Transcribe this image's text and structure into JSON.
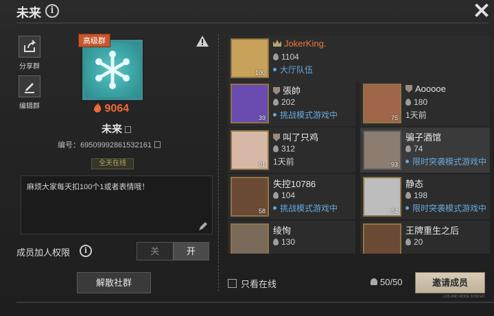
{
  "header": {
    "title": "未来",
    "info_icon": "info-icon",
    "close_icon": "close-icon"
  },
  "side": [
    {
      "label": "分享群",
      "icon": "share-icon"
    },
    {
      "label": "编辑群",
      "icon": "edit-icon"
    }
  ],
  "group": {
    "badge": "高级群",
    "avatar_icon": "snowflake-icon",
    "heat": "9064",
    "name": "未来",
    "id_text": "编号：69509992861532161",
    "online_tag": "全天在线",
    "notice": "麻烦大家每天扣100个1或者表情哦！"
  },
  "permission": {
    "label": "成员加人权限",
    "off": "关",
    "on": "开",
    "value": "开"
  },
  "dissolve_label": "解散社群",
  "members": [
    {
      "name": "JokerKing.",
      "heat": "1104",
      "status": "大厅队伍",
      "level": "100",
      "online": true,
      "leader": true,
      "color": "#c8a15a"
    },
    {
      "name": "張帥",
      "heat": "202",
      "status": "挑战模式游戏中",
      "level": "39",
      "online": true,
      "color": "#6a4bb0"
    },
    {
      "name": "Aooooe",
      "heat": "180",
      "status": "1天前",
      "level": "75",
      "online": false,
      "color": "#a0664a"
    },
    {
      "name": "叫了只鸡",
      "heat": "312",
      "status": "1天前",
      "level": "91",
      "online": false,
      "color": "#d7b7a5"
    },
    {
      "name": "骗子酒馆",
      "heat": "74",
      "status": "限时突袭模式游戏中",
      "level": "93",
      "online": true,
      "color": "#8d7c70"
    },
    {
      "name": "失控10786",
      "heat": "104",
      "status": "挑战模式游戏中",
      "level": "58",
      "online": true,
      "color": "#6b4a35"
    },
    {
      "name": "静态",
      "heat": "198",
      "status": "限时突袭模式游戏中",
      "level": "84",
      "online": true,
      "color": "#bdbdbd"
    },
    {
      "name": "绫恂",
      "heat": "130",
      "status": "",
      "level": "",
      "online": false,
      "color": "#7a6a5a"
    },
    {
      "name": "王牌重生之后",
      "heat": "20",
      "status": "",
      "level": "",
      "online": false,
      "color": "#6b4a35"
    }
  ],
  "footer": {
    "only_online": "只看在线",
    "count": "50/50",
    "invite": "邀请成员"
  },
  "watermark": "LOS AND MODE SYNCED"
}
